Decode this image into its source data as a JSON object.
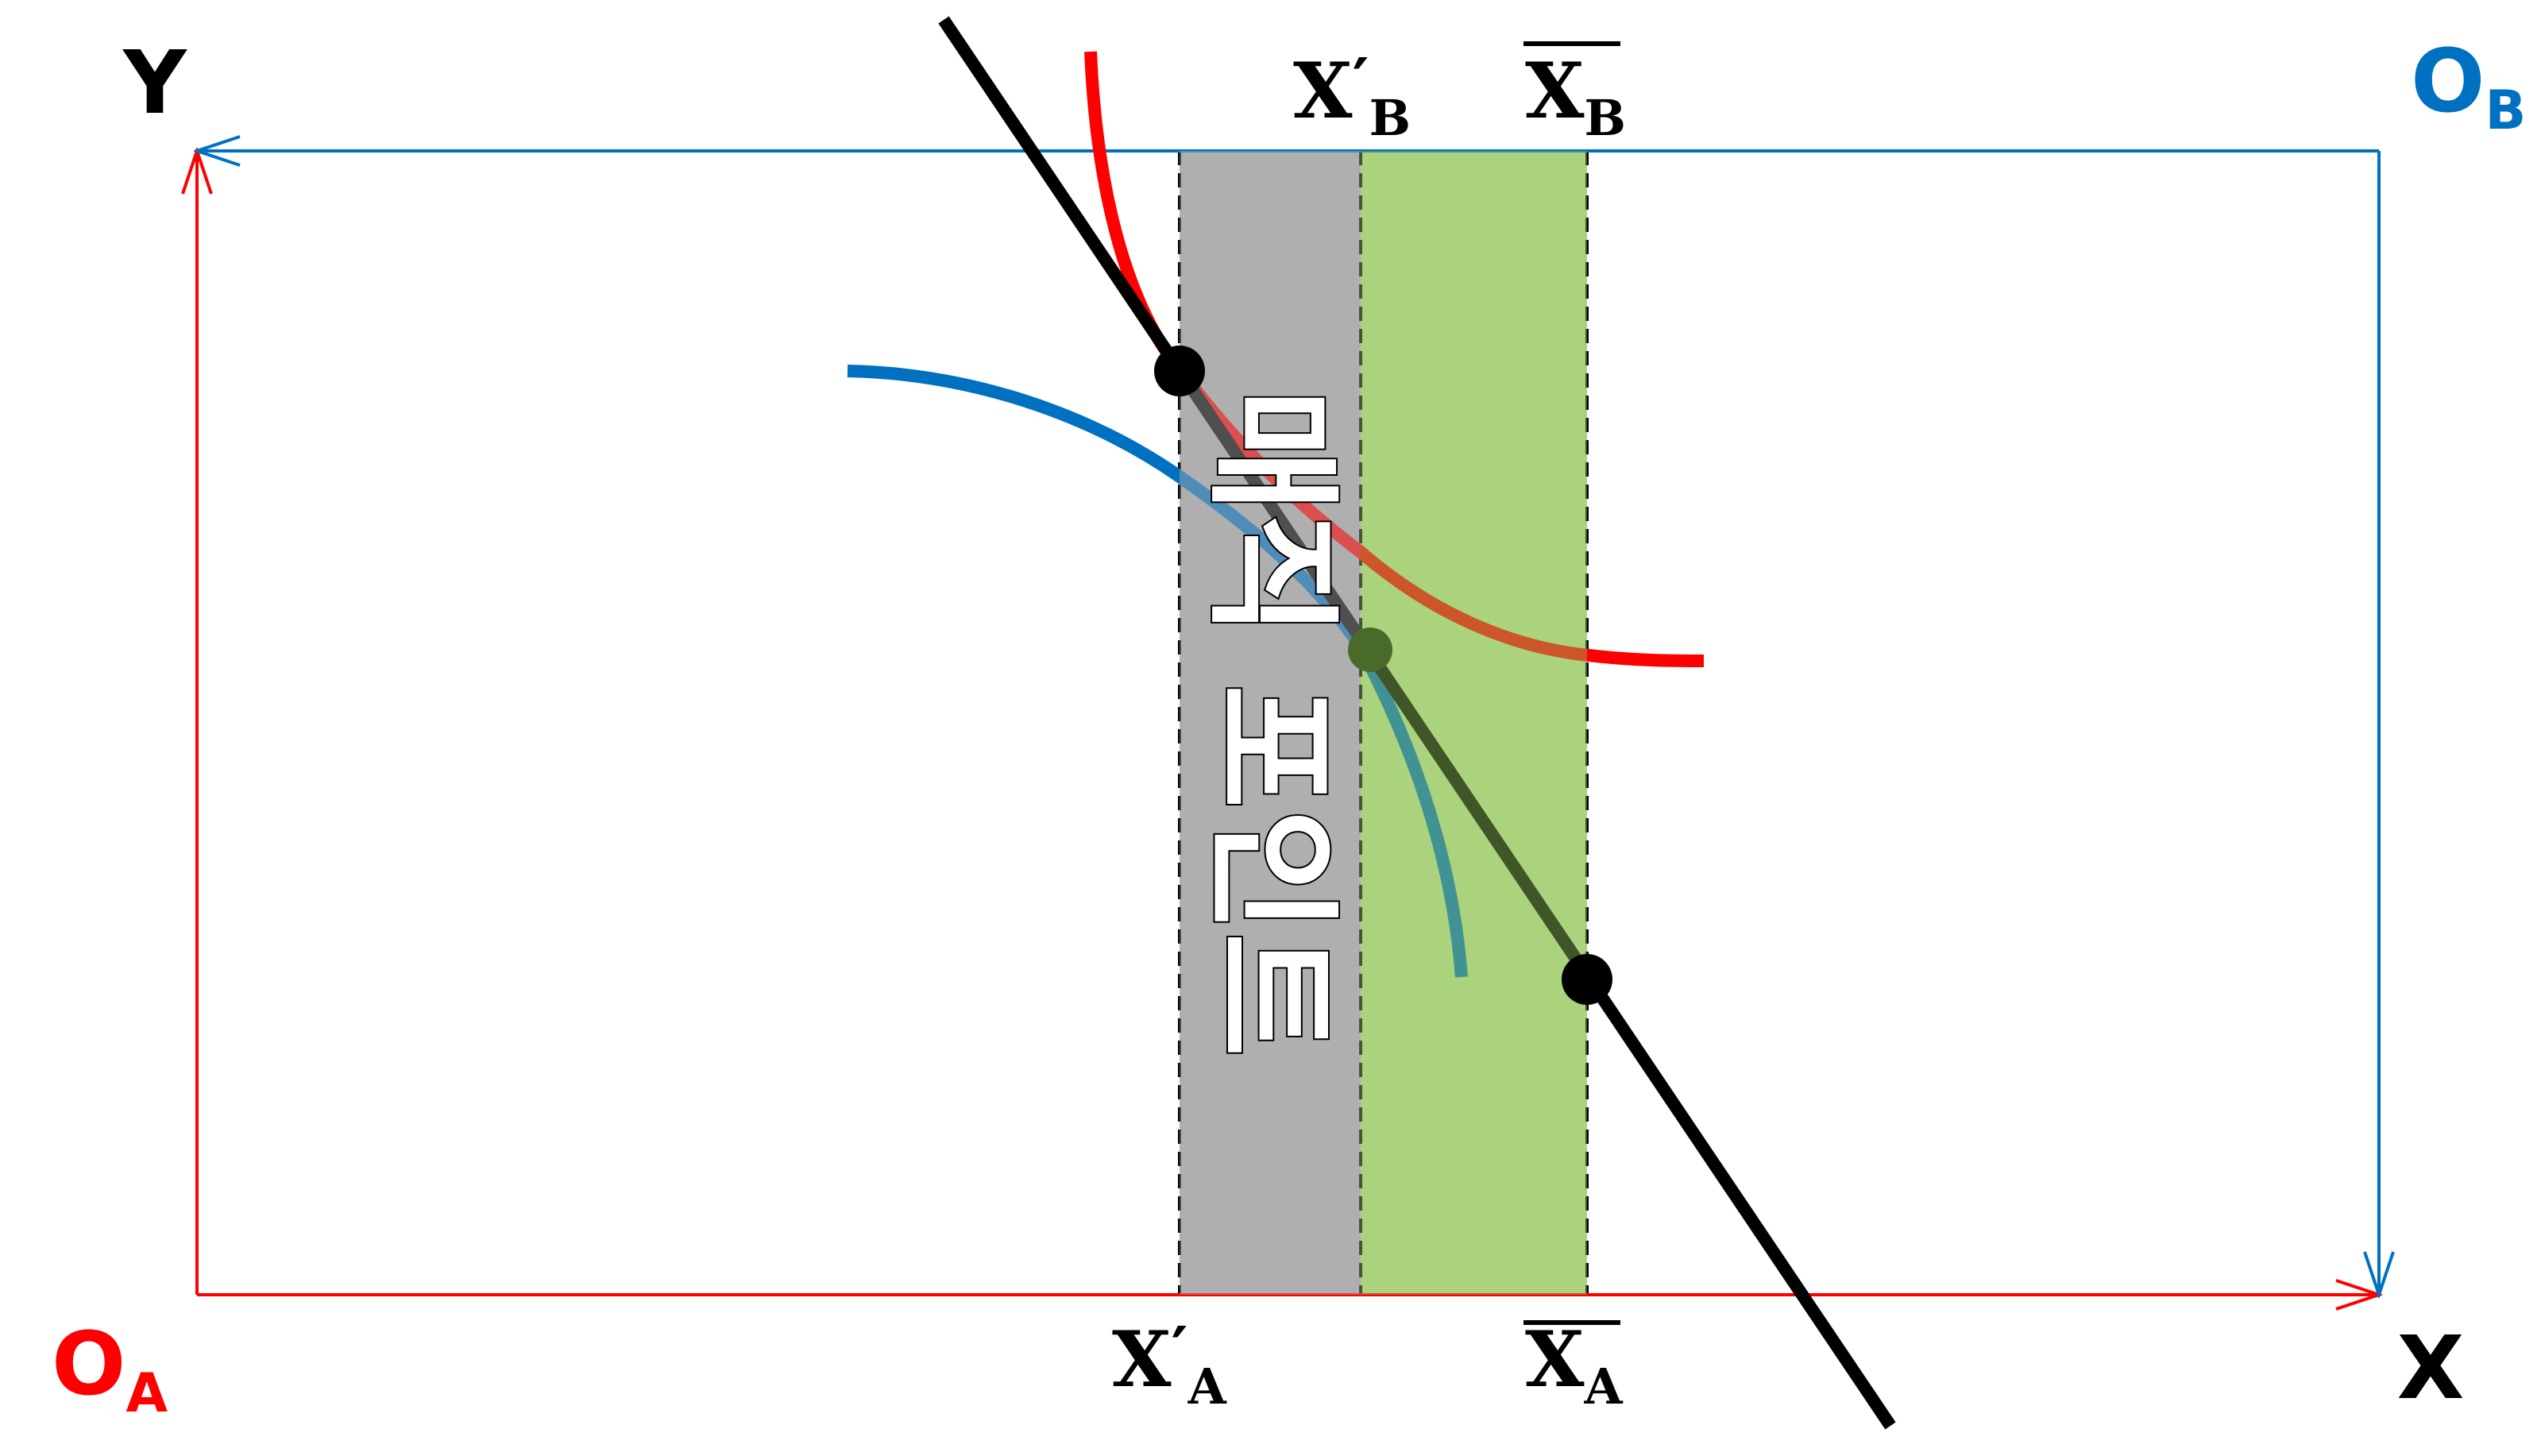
{
  "axes": {
    "y_label": "Y",
    "x_label": "X",
    "origin_a": {
      "main": "O",
      "sub": "A"
    },
    "origin_b": {
      "main": "O",
      "sub": "B"
    }
  },
  "ticks": {
    "xa_prime": {
      "main": "X",
      "mark": "′",
      "sub": "A"
    },
    "xb_prime": {
      "main": "X",
      "mark": "′",
      "sub": "B"
    },
    "xa_bar": {
      "main": "X",
      "sub": "A"
    },
    "xb_bar": {
      "main": "X",
      "sub": "B"
    }
  },
  "region_text": "매직 포인트",
  "colors": {
    "origin_a": "#ff0000",
    "origin_b": "#0070c0",
    "gray_band": "#b0b0b0",
    "green_band": "#c3e29a",
    "budget_line": "#000000"
  }
}
